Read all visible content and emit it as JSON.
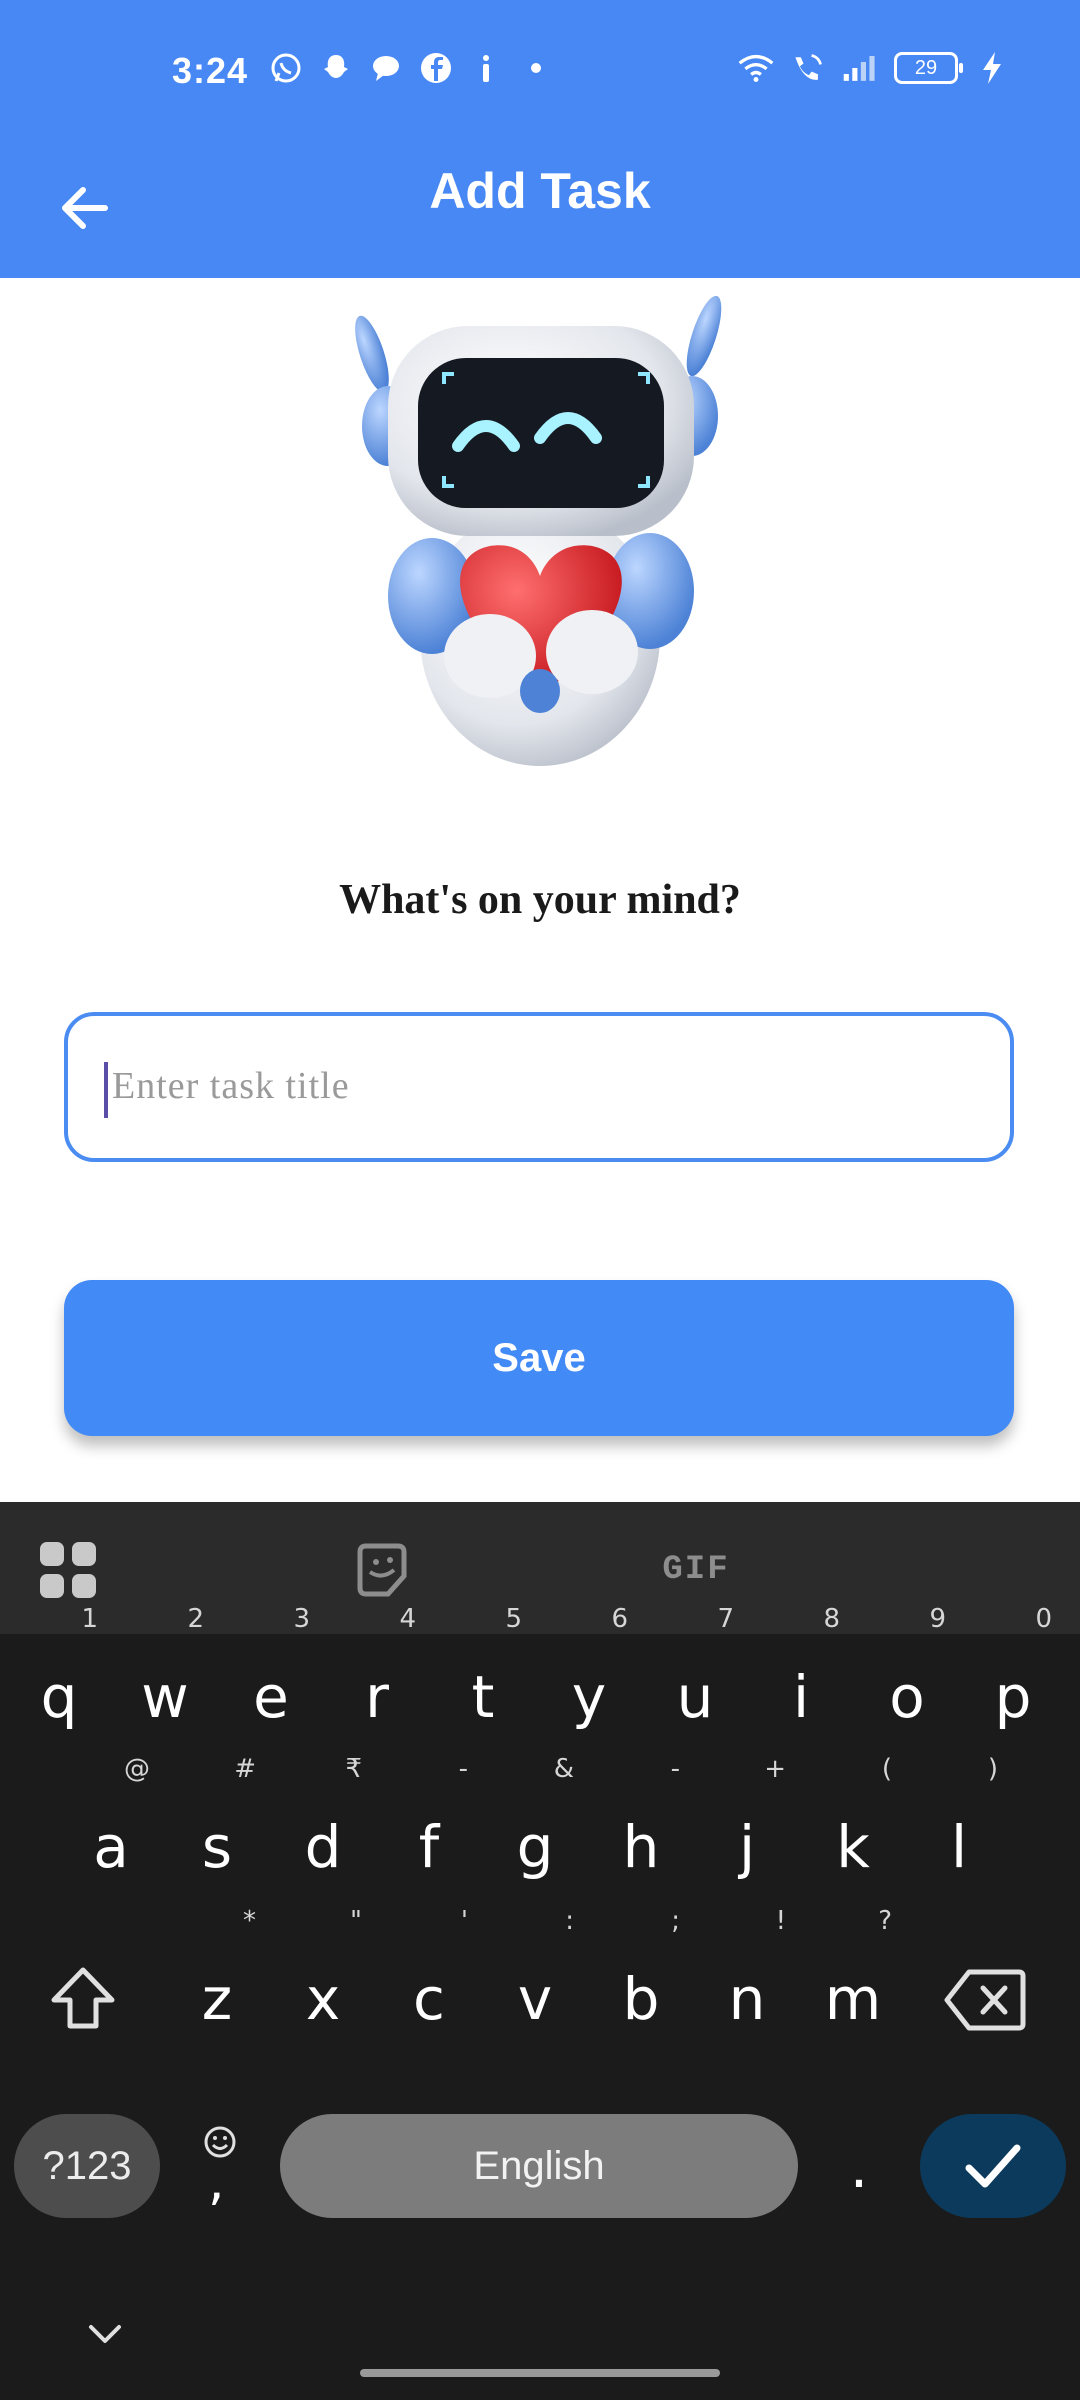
{
  "status_bar": {
    "time": "3:24",
    "battery": "29",
    "icons": [
      "whatsapp-icon",
      "snapchat-icon",
      "chat-bubble-icon",
      "facebook-icon",
      "info-icon",
      "dot-icon",
      "wifi-icon",
      "wifi-call-icon",
      "signal-icon",
      "charging-icon"
    ]
  },
  "app_bar": {
    "title": "Add Task",
    "back_icon": "arrow-left-icon",
    "color": "#4788f4"
  },
  "content": {
    "prompt": "What's on your mind?",
    "input": {
      "placeholder": "Enter task title",
      "value": ""
    },
    "save_label": "Save",
    "accent": "#428af6"
  },
  "keyboard": {
    "toolbar_icons": [
      "apps-grid-icon",
      "sticker-icon",
      "gif-icon"
    ],
    "gif_label": "GIF",
    "row1": [
      {
        "k": "q",
        "h": "1"
      },
      {
        "k": "w",
        "h": "2"
      },
      {
        "k": "e",
        "h": "3"
      },
      {
        "k": "r",
        "h": "4"
      },
      {
        "k": "t",
        "h": "5"
      },
      {
        "k": "y",
        "h": "6"
      },
      {
        "k": "u",
        "h": "7"
      },
      {
        "k": "i",
        "h": "8"
      },
      {
        "k": "o",
        "h": "9"
      },
      {
        "k": "p",
        "h": "0"
      }
    ],
    "row2": [
      {
        "k": "a",
        "h": "@"
      },
      {
        "k": "s",
        "h": "#"
      },
      {
        "k": "d",
        "h": "₹"
      },
      {
        "k": "f",
        "h": "-"
      },
      {
        "k": "g",
        "h": "&"
      },
      {
        "k": "h",
        "h": "-"
      },
      {
        "k": "j",
        "h": "+"
      },
      {
        "k": "k",
        "h": "("
      },
      {
        "k": "l",
        "h": ")"
      }
    ],
    "row3": [
      {
        "k": "z",
        "h": "*"
      },
      {
        "k": "x",
        "h": "\""
      },
      {
        "k": "c",
        "h": "'"
      },
      {
        "k": "v",
        "h": ":"
      },
      {
        "k": "b",
        "h": ";"
      },
      {
        "k": "n",
        "h": "!"
      },
      {
        "k": "m",
        "h": "?"
      }
    ],
    "symbols_label": "?123",
    "comma_label": ",",
    "space_label": "English",
    "period_label": ".",
    "enter_icon": "checkmark-icon"
  }
}
